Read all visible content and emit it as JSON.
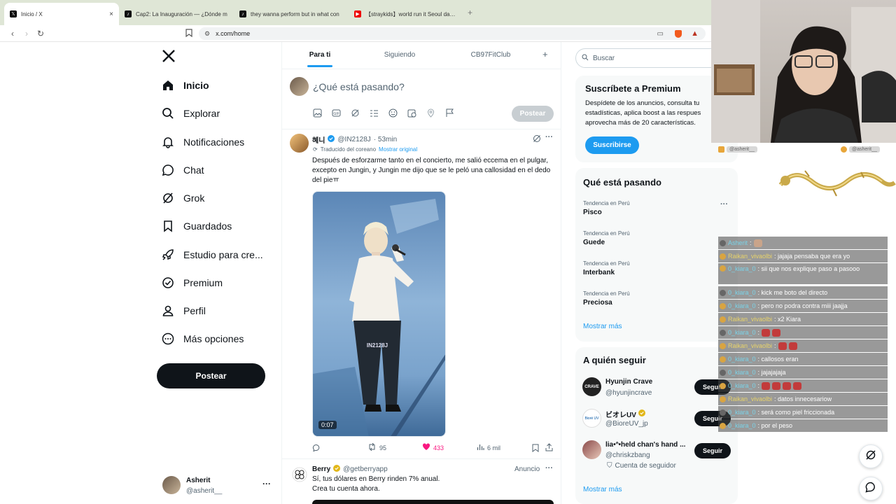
{
  "browser": {
    "tabs": [
      {
        "title": "Inicio / X",
        "icon": "x-logo-icon",
        "active": true
      },
      {
        "title": "Cap2: La Inauguración — ¿Dónde m",
        "icon": "tiktok-icon"
      },
      {
        "title": "they wanna perform but in what con",
        "icon": "tiktok-icon"
      },
      {
        "title": "【straykids】world run it Seoul day4 0",
        "icon": "youtube-icon"
      }
    ],
    "url": "x.com/home"
  },
  "nav": {
    "items": [
      {
        "label": "Inicio",
        "icon": "home-icon"
      },
      {
        "label": "Explorar",
        "icon": "search-icon"
      },
      {
        "label": "Notificaciones",
        "icon": "bell-icon"
      },
      {
        "label": "Chat",
        "icon": "chat-icon"
      },
      {
        "label": "Grok",
        "icon": "grok-icon"
      },
      {
        "label": "Guardados",
        "icon": "bookmark-icon"
      },
      {
        "label": "Estudio para cre...",
        "icon": "rocket-icon"
      },
      {
        "label": "Premium",
        "icon": "verified-icon"
      },
      {
        "label": "Perfil",
        "icon": "person-icon"
      },
      {
        "label": "Más opciones",
        "icon": "more-circle-icon"
      }
    ],
    "post_label": "Postear",
    "account": {
      "name": "Asherit",
      "handle": "@asherit__"
    }
  },
  "feed": {
    "tabs": [
      "Para ti",
      "Siguiendo",
      "CB97FitClub"
    ],
    "compose_placeholder": "¿Qué está pasando?",
    "compose_post": "Postear",
    "tweet": {
      "name": "혜니",
      "handle": "@IN2128J",
      "time": "· 53min",
      "translated": "Traducido del coreano",
      "show_original": "Mostrar original",
      "text": "Después de esforzarme tanto en el concierto, me salió eccema en el pulgar, excepto en Jungin, y Jungin me dijo que se le peló una callosidad en el dedo del pieㅠ",
      "video_time": "0:07",
      "video_caption": "IN2128J",
      "retweets": "95",
      "likes": "433",
      "views": "6 mil"
    },
    "ad": {
      "name": "Berry",
      "handle": "@getberryapp",
      "label": "Anuncio",
      "text1": "Sí, tus dólares en Berry rinden 7% anual.",
      "text2": "Crea tu cuenta ahora."
    }
  },
  "right": {
    "search_placeholder": "Buscar",
    "premium": {
      "title": "Suscríbete a Premium",
      "body": "Despídete de los anuncios, consulta tu estadísticas, aplica boost a las respues aprovecha más de 20 características.",
      "button": "Suscribirse"
    },
    "trends": {
      "title": "Qué está pasando",
      "items": [
        {
          "context": "Tendencia en Perú",
          "name": "Pisco"
        },
        {
          "context": "Tendencia en Perú",
          "name": "Guede"
        },
        {
          "context": "Tendencia en Perú",
          "name": "Interbank"
        },
        {
          "context": "Tendencia en Perú",
          "name": "Preciosa"
        }
      ],
      "more": "Mostrar más"
    },
    "follow": {
      "title": "A quién seguir",
      "items": [
        {
          "name": "Hyunjin Crave",
          "handle": "@hyunjincrave",
          "button": "Seguir"
        },
        {
          "name": "ビオレUV",
          "handle": "@BioreUV_jp",
          "button": "Seguir"
        },
        {
          "name": "lia•ᐢ•held chan's hand ...",
          "handle": "@chriskzbang",
          "note": "Cuenta de seguidor",
          "button": "Seguir"
        }
      ],
      "more": "Mostrar más"
    }
  },
  "overlay": {
    "handle_left": "@asherit__",
    "handle_right": "@asherit__",
    "chat": [
      {
        "user": "Asherit",
        "msg": ":",
        "color": "cyan",
        "emotes": 1
      },
      {
        "user": "Raikan_vivaolbi",
        "msg": ": jajaja pensaba que era yo",
        "color": "yellow",
        "emotes": 0
      },
      {
        "user": "0_kiara_0",
        "msg": ": sii que nos explique paso a pasooo",
        "color": "cyan",
        "emotes": 0
      },
      {
        "user": "0_kiara_0",
        "msg": ": kick me boto del directo",
        "color": "cyan",
        "emotes": 0
      },
      {
        "user": "0_kiara_0",
        "msg": ": pero no podra contra miii jaajja",
        "color": "cyan",
        "emotes": 0
      },
      {
        "user": "Raikan_vivaolbi",
        "msg": ": x2 Kiara",
        "color": "yellow",
        "emotes": 0
      },
      {
        "user": "0_kiara_0",
        "msg": ":",
        "color": "cyan",
        "emotes": 2
      },
      {
        "user": "Raikan_vivaolbi",
        "msg": ":",
        "color": "yellow",
        "emotes": 2
      },
      {
        "user": "0_kiara_0",
        "msg": ": callosos eran",
        "color": "cyan",
        "emotes": 0
      },
      {
        "user": "0_kiara_0",
        "msg": ": jajajajaja",
        "color": "cyan",
        "emotes": 0
      },
      {
        "user": "0_kiara_0",
        "msg": ":",
        "color": "cyan",
        "emotes": 4
      },
      {
        "user": "Raikan_vivaolbi",
        "msg": ": datos innecesariow",
        "color": "yellow",
        "emotes": 0
      },
      {
        "user": "0_kiara_0",
        "msg": ": será como piel friccionada",
        "color": "cyan",
        "emotes": 0
      },
      {
        "user": "0_kiara_0",
        "msg": ": por el peso",
        "color": "cyan",
        "emotes": 0
      }
    ]
  }
}
